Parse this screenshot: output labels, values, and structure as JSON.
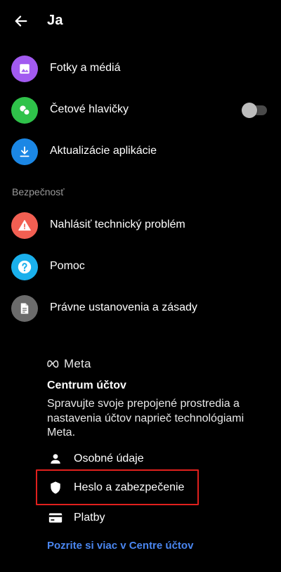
{
  "header": {
    "title": "Ja"
  },
  "rows": [
    {
      "label": "Fotky a médiá",
      "icon": "photo-icon",
      "color": "#a25af0"
    },
    {
      "label": "Četové hlavičky",
      "icon": "chat-heads-icon",
      "color": "#2fc24a",
      "toggle_on": false
    },
    {
      "label": "Aktualizácie aplikácie",
      "icon": "download-icon",
      "color": "#1b87e5"
    }
  ],
  "section_header": "Bezpečnosť",
  "support_rows": [
    {
      "label": "Nahlásiť technický problém",
      "icon": "warning-icon",
      "color": "#f25f52"
    },
    {
      "label": "Pomoc",
      "icon": "help-icon",
      "color": "#1ab0ec"
    },
    {
      "label": "Právne ustanovenia a zásady",
      "icon": "document-icon",
      "color": "#6b6b6b"
    }
  ],
  "accounts_center": {
    "brand": "Meta",
    "title": "Centrum účtov",
    "description": "Spravujte svoje prepojené prostredia a nastavenia účtov naprieč technológiami Meta.",
    "items": [
      {
        "label": "Osobné údaje",
        "icon": "person-icon"
      },
      {
        "label": "Heslo a zabezpečenie",
        "icon": "shield-icon",
        "highlighted": true
      },
      {
        "label": "Platby",
        "icon": "card-icon"
      }
    ],
    "link": "Pozrite si viac v Centre účtov",
    "link_color": "#4a86f0",
    "highlight_color": "#e0201d"
  }
}
